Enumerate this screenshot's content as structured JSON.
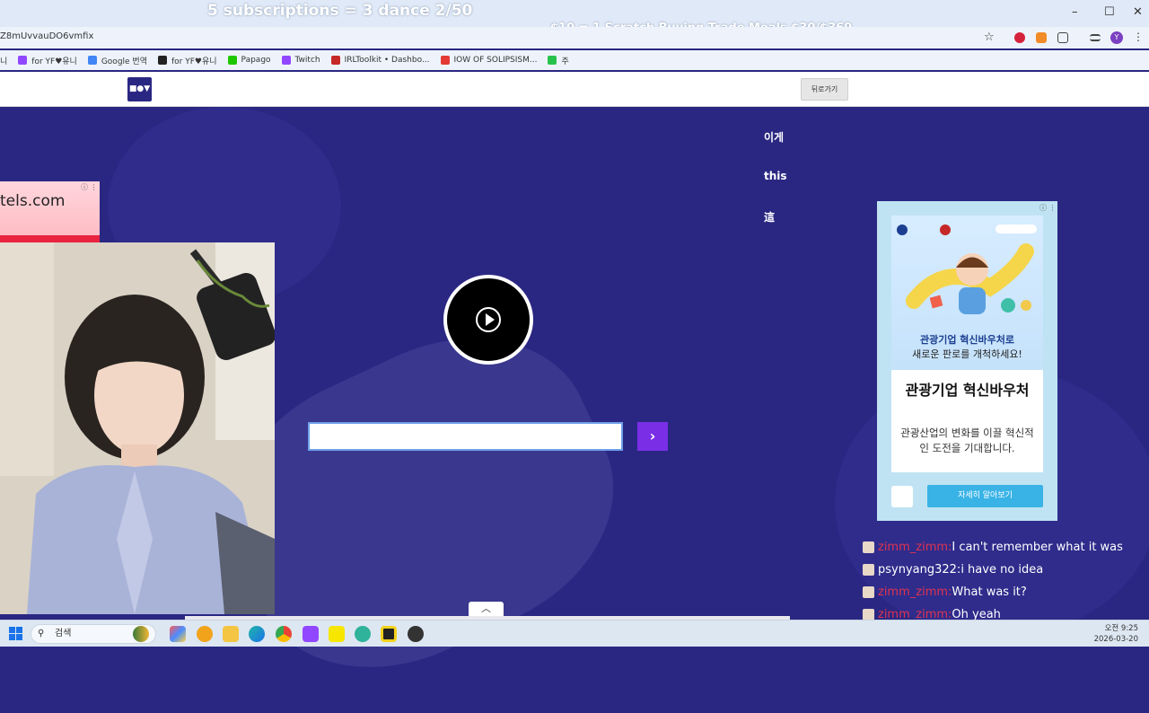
{
  "overlay": {
    "top_text": "5 subscriptions = 3 dance 2/50",
    "goal_text": "$10 = 1 Scratch Buying Trade Meals $30/$369"
  },
  "browser": {
    "url": "Z8mUvvauDO6vmfix",
    "window_controls": [
      "–",
      "☐",
      "✕"
    ],
    "profile_initial": "Y",
    "bookmarks": [
      {
        "label": "니",
        "color": "#5b63d9"
      },
      {
        "label": "for YF♥유니",
        "color": "#9146ff"
      },
      {
        "label": "Google 번역",
        "color": "#4285f4"
      },
      {
        "label": "for YF♥유니",
        "color": "#222222"
      },
      {
        "label": "Papago",
        "color": "#1ec800"
      },
      {
        "label": "Twitch",
        "color": "#9146ff"
      },
      {
        "label": "IRLToolkit • Dashbo...",
        "color": "#c62828"
      },
      {
        "label": "IOW OF SOLIPSISM...",
        "color": "#e53935"
      },
      {
        "label": "주",
        "color": "#27c24c"
      }
    ]
  },
  "site": {
    "logo": "■●▼",
    "back_button": "뒤로가기",
    "side_texts": [
      "이게",
      "this",
      "這"
    ],
    "answer_input": {
      "value": "",
      "placeholder": ""
    },
    "submit_label": "›"
  },
  "left_ad": {
    "text": "tels.com"
  },
  "right_ad": {
    "caption_bold": "관광기업 혁신바우처로",
    "caption": "새로운 판로를 개척하세요!",
    "headline": "관광기업 혁신바우처",
    "body": "관광산업의 변화를 이끌 혁신적인 도전을 기대합니다.",
    "button": "자세히 알아보기"
  },
  "chat": [
    {
      "user": "zimm_zimm:",
      "message": "I can't remember what it was",
      "user_color": "red"
    },
    {
      "user": "psynyang322:",
      "message": "i have no idea",
      "user_color": "white"
    },
    {
      "user": "zimm_zimm:",
      "message": "What was it?",
      "user_color": "red"
    },
    {
      "user": "zimm_zimm:",
      "message": "Oh yeah",
      "user_color": "red"
    }
  ],
  "taskbar": {
    "search_label": "검색",
    "time": "오전 9:25",
    "date": "2026-03-20"
  },
  "colors": {
    "page_bg": "#2a2783",
    "accent_button": "#7a2ee6",
    "chat_user_red": "#e0334f"
  }
}
